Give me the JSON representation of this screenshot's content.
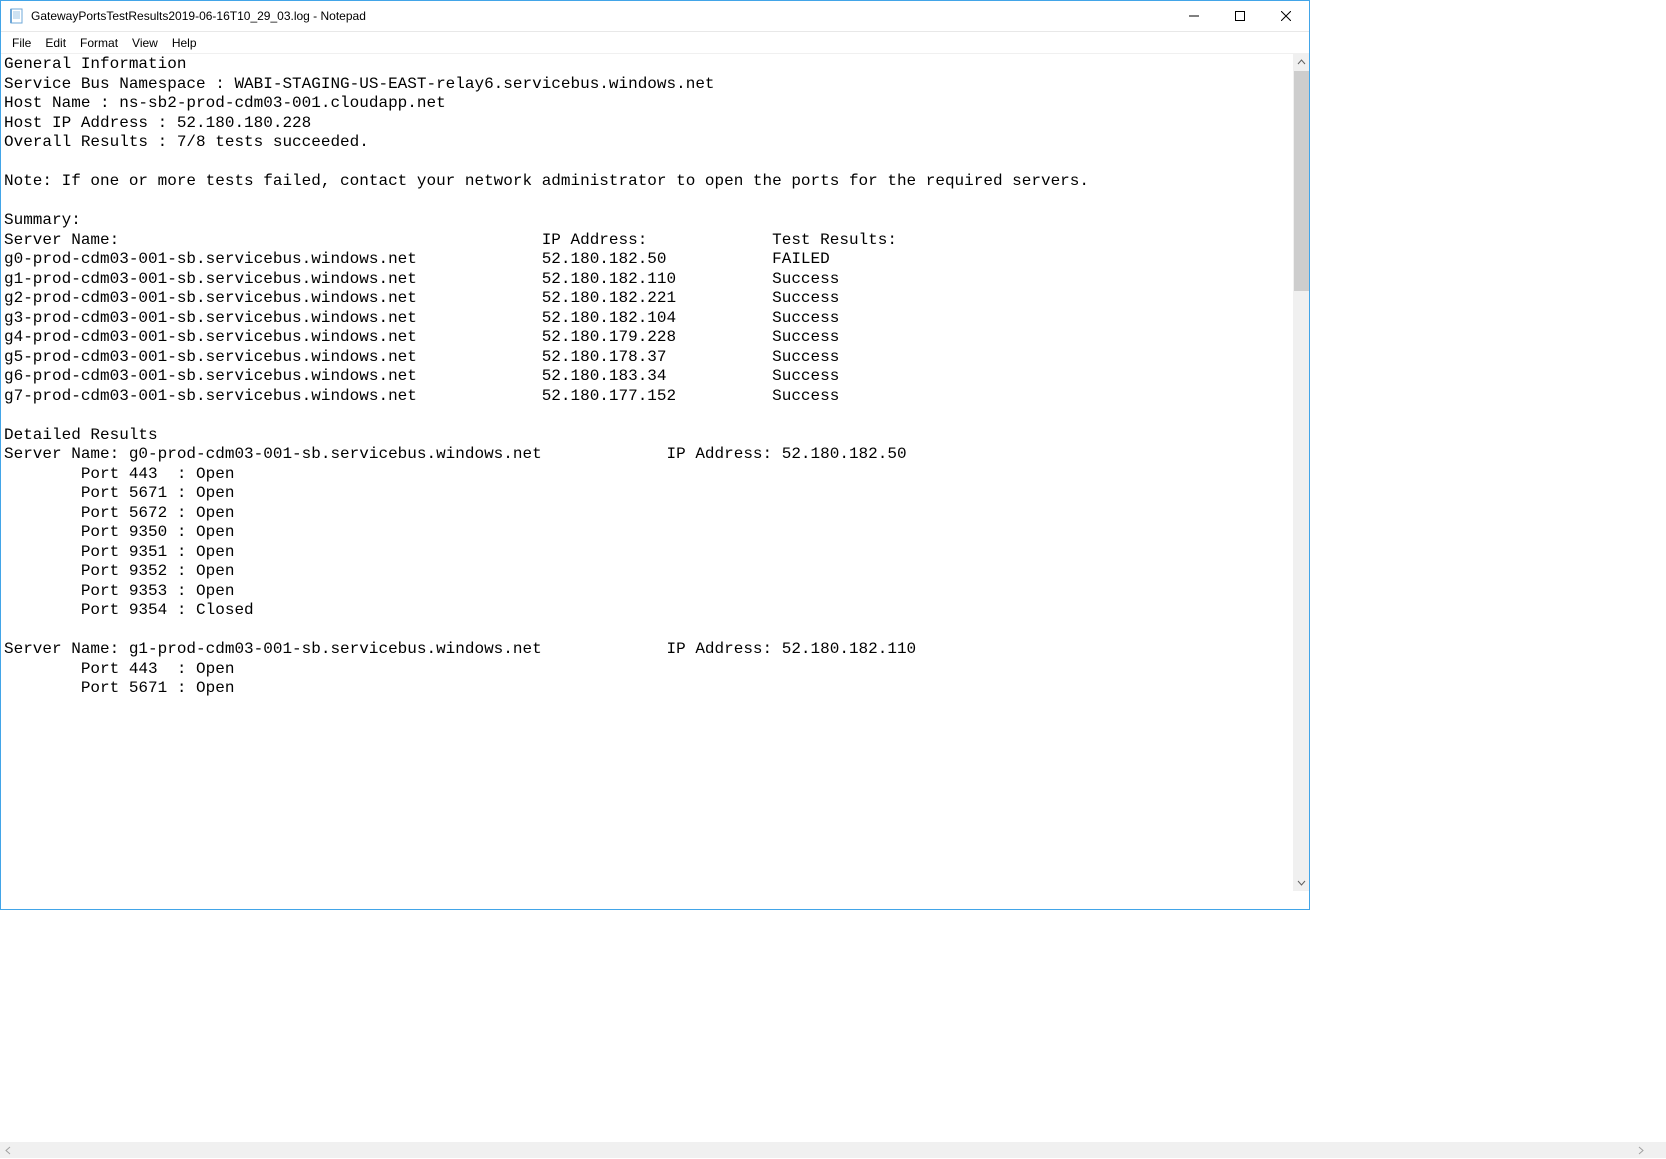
{
  "window": {
    "title": "GatewayPortsTestResults2019-06-16T10_29_03.log - Notepad"
  },
  "menu": {
    "file": "File",
    "edit": "Edit",
    "format": "Format",
    "view": "View",
    "help": "Help"
  },
  "doc": {
    "general_heading": "General Information",
    "sb_namespace_label": "Service Bus Namespace : ",
    "sb_namespace_value": "WABI-STAGING-US-EAST-relay6.servicebus.windows.net",
    "hostname_label": "Host Name : ",
    "hostname_value": "ns-sb2-prod-cdm03-001.cloudapp.net",
    "host_ip_label": "Host IP Address : ",
    "host_ip_value": "52.180.180.228",
    "overall_label": "Overall Results : ",
    "overall_value": "7/8 tests succeeded.",
    "note": "Note: If one or more tests failed, contact your network administrator to open the ports for the required servers.",
    "summary_heading": "Summary:",
    "col_server": "Server Name:",
    "col_ip": "IP Address:",
    "col_result": "Test Results:",
    "summary": [
      {
        "server": "g0-prod-cdm03-001-sb.servicebus.windows.net",
        "ip": "52.180.182.50",
        "result": "FAILED"
      },
      {
        "server": "g1-prod-cdm03-001-sb.servicebus.windows.net",
        "ip": "52.180.182.110",
        "result": "Success"
      },
      {
        "server": "g2-prod-cdm03-001-sb.servicebus.windows.net",
        "ip": "52.180.182.221",
        "result": "Success"
      },
      {
        "server": "g3-prod-cdm03-001-sb.servicebus.windows.net",
        "ip": "52.180.182.104",
        "result": "Success"
      },
      {
        "server": "g4-prod-cdm03-001-sb.servicebus.windows.net",
        "ip": "52.180.179.228",
        "result": "Success"
      },
      {
        "server": "g5-prod-cdm03-001-sb.servicebus.windows.net",
        "ip": "52.180.178.37",
        "result": "Success"
      },
      {
        "server": "g6-prod-cdm03-001-sb.servicebus.windows.net",
        "ip": "52.180.183.34",
        "result": "Success"
      },
      {
        "server": "g7-prod-cdm03-001-sb.servicebus.windows.net",
        "ip": "52.180.177.152",
        "result": "Success"
      }
    ],
    "detailed_heading": "Detailed Results",
    "detailed": [
      {
        "server": "g0-prod-cdm03-001-sb.servicebus.windows.net",
        "ip": "52.180.182.50",
        "ports": [
          {
            "port": "443",
            "status": "Open"
          },
          {
            "port": "5671",
            "status": "Open"
          },
          {
            "port": "5672",
            "status": "Open"
          },
          {
            "port": "9350",
            "status": "Open"
          },
          {
            "port": "9351",
            "status": "Open"
          },
          {
            "port": "9352",
            "status": "Open"
          },
          {
            "port": "9353",
            "status": "Open"
          },
          {
            "port": "9354",
            "status": "Closed"
          }
        ]
      },
      {
        "server": "g1-prod-cdm03-001-sb.servicebus.windows.net",
        "ip": "52.180.182.110",
        "ports": [
          {
            "port": "443",
            "status": "Open"
          },
          {
            "port": "5671",
            "status": "Open"
          }
        ]
      }
    ],
    "server_name_prefix": "Server Name: ",
    "ip_addr_prefix": "IP Address: ",
    "port_prefix": "Port ",
    "port_sep": " : "
  }
}
